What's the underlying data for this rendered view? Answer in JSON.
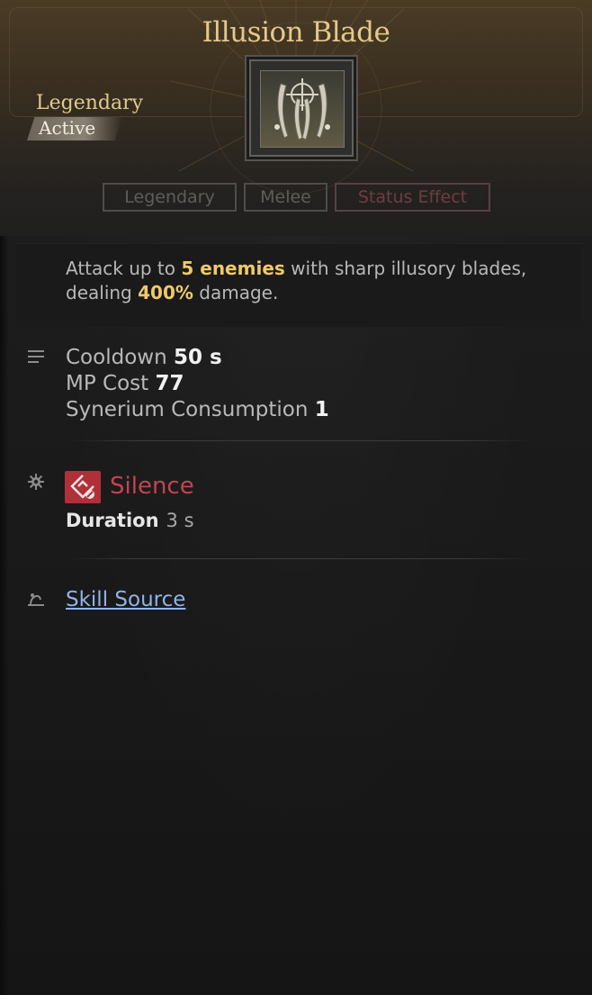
{
  "skill": {
    "title": "Illusion Blade",
    "grade": "Legendary",
    "type": "Active"
  },
  "tags": [
    "Legendary",
    "Melee",
    "Status Effect"
  ],
  "description": {
    "part1": "Attack up to ",
    "highlight1": "5 enemies",
    "part2": " with sharp illusory blades, dealing ",
    "highlight2": "400%",
    "part3": " damage."
  },
  "stats": {
    "cooldown_label": "Cooldown",
    "cooldown_value": "50 s",
    "mp_label": "MP Cost",
    "mp_value": "77",
    "synerium_label": "Synerium Consumption",
    "synerium_value": "1"
  },
  "status_effect": {
    "name": "Silence",
    "duration_label": "Duration",
    "duration_value": "3 s"
  },
  "source": {
    "link_label": "Skill Source"
  },
  "colors": {
    "title_gold": "#e3c98a",
    "highlight_gold": "#efc96a",
    "silence_red": "#c14450",
    "link_blue": "#8fb3e8"
  },
  "icons": {
    "skill": "crossed-blades-icon",
    "stats": "list-icon",
    "effect": "gear-icon",
    "silence": "silence-icon",
    "source": "source-icon"
  }
}
